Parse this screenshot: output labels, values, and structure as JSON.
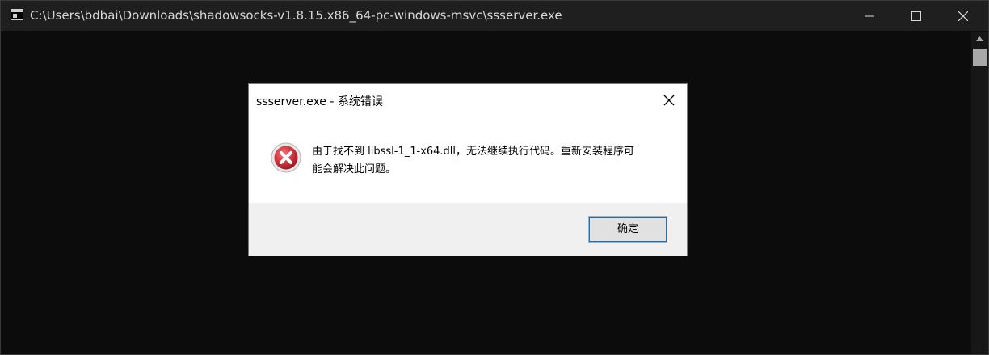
{
  "console": {
    "title": "C:\\Users\\bdbai\\Downloads\\shadowsocks-v1.8.15.x86_64-pc-windows-msvc\\ssserver.exe",
    "icon": "console-app-icon",
    "background": "#0c0c0c"
  },
  "dialog": {
    "title": "ssserver.exe - 系统错误",
    "message_line1": "由于找不到 libssl-1_1-x64.dll，无法继续执行代码。重新安装程序可",
    "message_line2": "能会解决此问题。",
    "ok_label": "确定",
    "icon": "error-icon",
    "accent": "#0078d7",
    "error_color": "#d1343c"
  }
}
